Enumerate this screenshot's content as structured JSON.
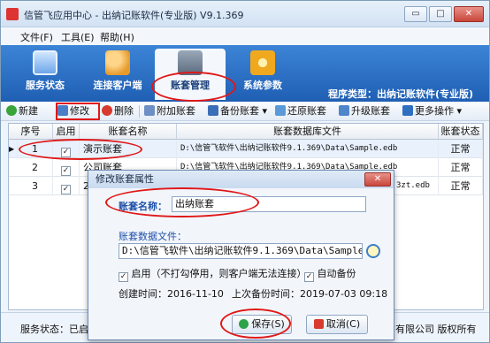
{
  "window": {
    "title": "信管飞应用中心 - 出纳记账软件(专业版) V9.1.369",
    "controls": {
      "minimize": "▭",
      "maximize": "□",
      "close": "✕"
    }
  },
  "menu": [
    "文件(F)",
    "工具(E)",
    "帮助(H)"
  ],
  "nav": {
    "items": [
      {
        "label": "服务状态",
        "icon": "monitor-icon"
      },
      {
        "label": "连接客户端",
        "icon": "people-icon"
      },
      {
        "label": "账套管理",
        "icon": "database-icon"
      },
      {
        "label": "系统参数",
        "icon": "gear-icon"
      }
    ],
    "program_type": "程序类型：出纳记账软件(专业版)"
  },
  "toolbar": {
    "new": "新建",
    "edit": "修改",
    "delete": "删除",
    "attach": "附加账套",
    "backup": "备份账套 ▾",
    "restore": "还原账套",
    "upgrade": "升级账套",
    "more": "更多操作 ▾"
  },
  "grid": {
    "headers": [
      "序号",
      "启用",
      "账套名称",
      "账套数据库文件",
      "账套状态"
    ],
    "rows": [
      {
        "no": "1",
        "enabled": "✓",
        "name": "演示账套",
        "file": "D:\\信管飞软件\\出纳记账软件9.1.369\\Data\\Sample.edb",
        "status": "正常"
      },
      {
        "no": "2",
        "enabled": "✓",
        "name": "公司账套",
        "file": "D:\\信管飞软件\\出纳记账软件9.1.369\\Data\\Sample.edb",
        "status": "正常"
      },
      {
        "no": "3",
        "enabled": "✓",
        "name": "20",
        "file": "3zt.edb",
        "status": "正常"
      }
    ]
  },
  "status": {
    "service": "服务状态：已启动",
    "copyright": "有限公司 版权所有"
  },
  "dialog": {
    "title": "修改账套属性",
    "name_label": "账套名称：",
    "name_value": "出纳账套",
    "file_label": "账套数据文件：",
    "file_value": "D:\\信管飞软件\\出纳记账软件9.1.369\\Data\\Sample.edb",
    "enable_label": "启用（不打勾停用，则客户端无法连接）",
    "auto_backup_label": "自动备份",
    "created_label": "创建时间：2016-11-10",
    "last_backup_label": "上次备份时间：2019-07-03 09:18",
    "save": "保存(S)",
    "cancel": "取消(C)",
    "check": "✓"
  }
}
